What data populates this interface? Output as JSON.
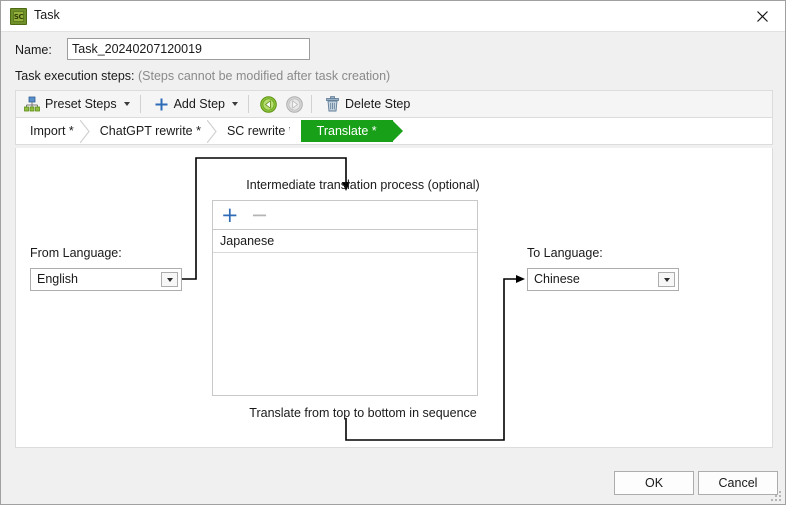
{
  "window": {
    "title": "Task",
    "app_icon": "chip-icon",
    "app_icon_text": "SC",
    "close_icon": "close-icon"
  },
  "name_field": {
    "label": "Name:",
    "value": "Task_20240207120019",
    "placeholder": ""
  },
  "steps_header": {
    "label": "Task execution steps:",
    "hint": "(Steps cannot be modified after task creation)"
  },
  "toolbar": {
    "preset_steps_label": "Preset Steps",
    "preset_steps_icon": "hierarchy-icon",
    "add_step_label": "Add Step",
    "add_step_icon": "plus-icon",
    "move_back_icon": "circle-arrow-left-icon",
    "move_forward_icon": "circle-arrow-right-icon",
    "delete_step_label": "Delete Step",
    "delete_step_icon": "trash-icon"
  },
  "steps": [
    {
      "label": "Import *",
      "active": false
    },
    {
      "label": "ChatGPT rewrite *",
      "active": false
    },
    {
      "label": "SC rewrite *",
      "active": false
    },
    {
      "label": "Translate *",
      "active": true
    }
  ],
  "translate_panel": {
    "from_label": "From Language:",
    "from_value": "English",
    "to_label": "To Language:",
    "to_value": "Chinese",
    "middle_caption": "Intermediate translation process (optional)",
    "middle_footnote": "Translate from top to bottom in sequence",
    "add_icon": "plus-icon",
    "remove_icon": "minus-icon",
    "middle_items": [
      "Japanese"
    ]
  },
  "footer": {
    "ok_label": "OK",
    "cancel_label": "Cancel",
    "resize_grip_icon": "resize-grip-icon"
  },
  "colors": {
    "active_step_green": "#18a018",
    "accent_blue": "#2e6cb8",
    "window_bg": "#f0f0f0"
  }
}
